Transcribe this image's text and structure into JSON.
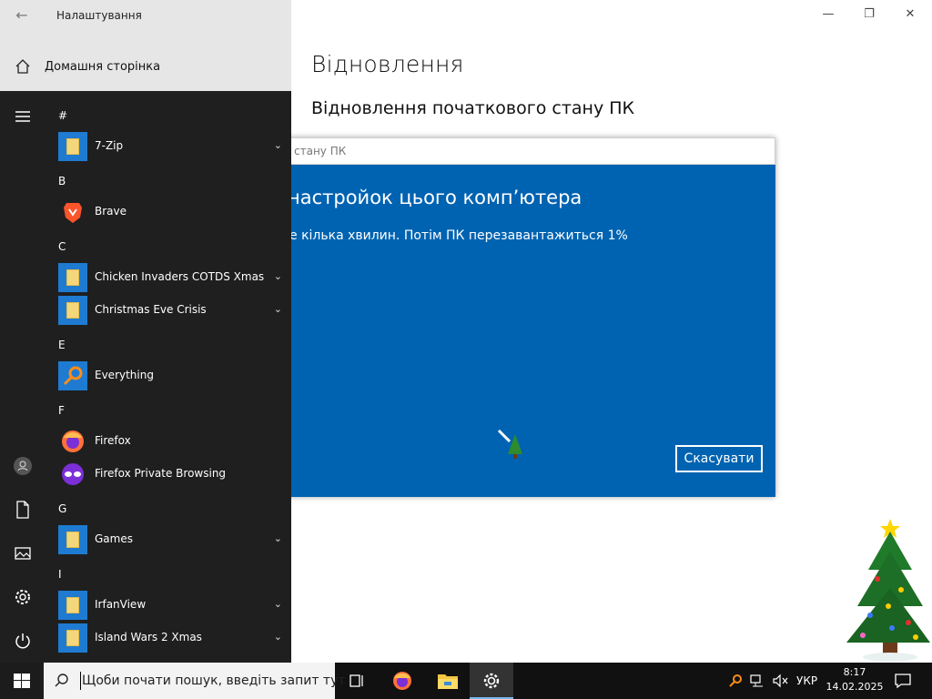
{
  "settings": {
    "window_title": "Налаштування",
    "home_label": "Домашня сторінка",
    "page_heading": "Відновлення",
    "section_heading": "Відновлення початкового стану ПК"
  },
  "dialog": {
    "bar_title": "стану ПК",
    "title": "настройок цього комп’ютера",
    "status": "е кілька хвилин. Потім ПК перезавантажиться 1%",
    "progress_percent": 1,
    "cancel_label": "Скасувати",
    "background_color": "#0063b1"
  },
  "start_menu": {
    "groups": [
      {
        "letter": "#",
        "apps": [
          {
            "label": "7-Zip",
            "icon": "folder-icon",
            "expandable": true
          }
        ]
      },
      {
        "letter": "B",
        "apps": [
          {
            "label": "Brave",
            "icon": "brave-icon",
            "expandable": false
          }
        ]
      },
      {
        "letter": "C",
        "apps": [
          {
            "label": "Chicken Invaders COTDS Xmas",
            "icon": "folder-icon",
            "expandable": true
          },
          {
            "label": "Christmas Eve Crisis",
            "icon": "folder-icon",
            "expandable": true
          }
        ]
      },
      {
        "letter": "E",
        "apps": [
          {
            "label": "Everything",
            "icon": "everything-icon",
            "expandable": false
          }
        ]
      },
      {
        "letter": "F",
        "apps": [
          {
            "label": "Firefox",
            "icon": "firefox-icon",
            "expandable": false
          },
          {
            "label": "Firefox Private Browsing",
            "icon": "firefox-private-icon",
            "expandable": false
          }
        ]
      },
      {
        "letter": "G",
        "apps": [
          {
            "label": "Games",
            "icon": "folder-icon",
            "expandable": true
          }
        ]
      },
      {
        "letter": "I",
        "apps": [
          {
            "label": "IrfanView",
            "icon": "folder-icon",
            "expandable": true
          },
          {
            "label": "Island Wars 2 Xmas",
            "icon": "folder-icon",
            "expandable": true
          }
        ]
      }
    ]
  },
  "taskbar": {
    "search_placeholder": "Щоби почати пошук, введіть запит тут",
    "language": "УКР",
    "time": "8:17",
    "date": "14.02.2025"
  }
}
